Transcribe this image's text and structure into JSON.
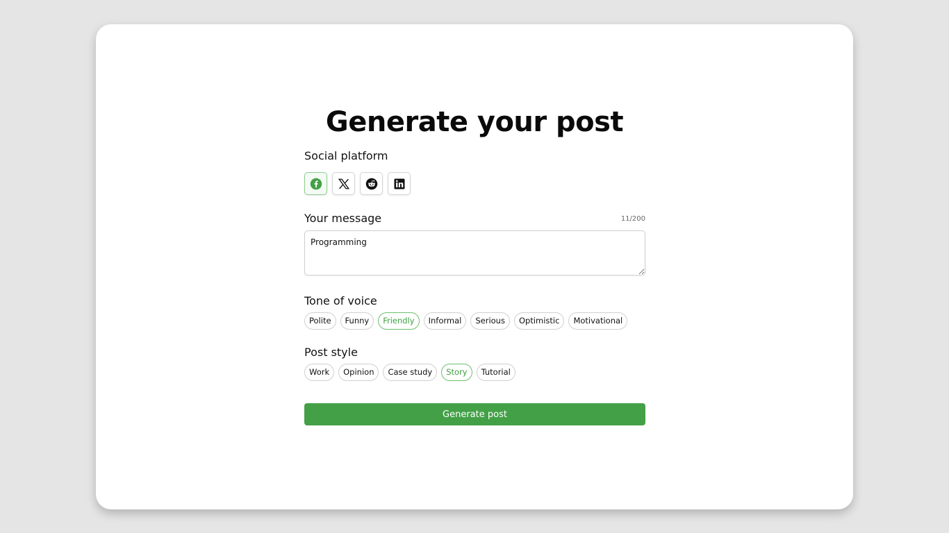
{
  "page": {
    "title": "Generate your post"
  },
  "platform": {
    "label": "Social platform",
    "options": [
      {
        "name": "Facebook",
        "icon": "facebook-icon",
        "selected": true
      },
      {
        "name": "X",
        "icon": "x-icon",
        "selected": false
      },
      {
        "name": "Reddit",
        "icon": "reddit-icon",
        "selected": false
      },
      {
        "name": "LinkedIn",
        "icon": "linkedin-icon",
        "selected": false
      }
    ]
  },
  "message": {
    "label": "Your message",
    "value": "Programming",
    "counter": "11/200"
  },
  "tone": {
    "label": "Tone of voice",
    "options": [
      "Polite",
      "Funny",
      "Friendly",
      "Informal",
      "Serious",
      "Optimistic",
      "Motivational"
    ],
    "selected": "Friendly"
  },
  "style": {
    "label": "Post style",
    "options": [
      "Work",
      "Opinion",
      "Case study",
      "Story",
      "Tutorial"
    ],
    "selected": "Story"
  },
  "actions": {
    "generate_label": "Generate post"
  },
  "colors": {
    "accent": "#43a047",
    "accent_text": "#3fa043",
    "background": "#e5e5e5"
  }
}
